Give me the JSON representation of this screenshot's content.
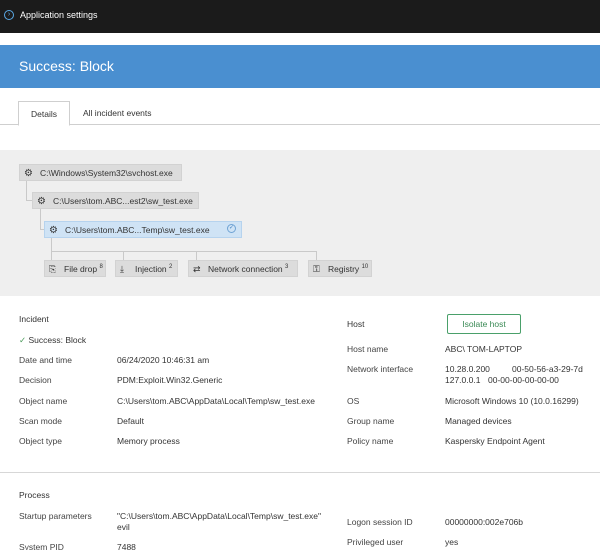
{
  "titlebar": {
    "title": "Application settings",
    "icon": "chevron-right-icon"
  },
  "header": {
    "title": "Success: Block",
    "color": "#4a8fd0"
  },
  "tabs": [
    {
      "label": "Details"
    },
    {
      "label": "All incident events"
    }
  ],
  "tree": {
    "root": "C:\\Windows\\System32\\svchost.exe",
    "child": "C:\\Users\\tom.ABC...est2\\sw_test.exe",
    "selected": "C:\\Users\\tom.ABC...Temp\\sw_test.exe",
    "leaves": [
      {
        "label": "File drop",
        "count": "8"
      },
      {
        "label": "Injection",
        "count": "2"
      },
      {
        "label": "Network connection",
        "count": "3"
      },
      {
        "label": "Registry",
        "count": "10"
      }
    ]
  },
  "incident": {
    "heading": "Incident",
    "status_check": "✓",
    "status": "Success: Block",
    "rows": [
      {
        "label": "Date and time",
        "value": "06/24/2020 10:46:31 am"
      },
      {
        "label": "Decision",
        "value": "PDM:Exploit.Win32.Generic"
      },
      {
        "label": "Object name",
        "value": "C:\\Users\\tom.ABC\\AppData\\Local\\Temp\\sw_test.exe"
      },
      {
        "label": "Scan mode",
        "value": "Default"
      },
      {
        "label": "Object type",
        "value": "Memory process"
      }
    ]
  },
  "host": {
    "heading": "Host",
    "isolate_button": "Isolate host",
    "host_name_label": "Host name",
    "host_name": "ABC\\ TOM-LAPTOP",
    "network_label": "Network interface",
    "net1_ip": "10.28.0.200",
    "net1_mac": "00-50-56-a3-29-7d",
    "net2_ip": "127.0.0.1",
    "net2_mac": "00-00-00-00-00-00",
    "os_label": "OS",
    "os": "Microsoft Windows 10 (10.0.16299)",
    "group_label": "Group name",
    "group": "Managed devices",
    "policy_label": "Policy name",
    "policy": "Kaspersky Endpoint Agent"
  },
  "process": {
    "heading": "Process",
    "startup_label": "Startup parameters",
    "startup_line1": "\"C:\\Users\\tom.ABC\\AppData\\Local\\Temp\\sw_test.exe\"",
    "startup_line2": "evil",
    "pid_label": "System PID",
    "pid": "7488",
    "logon_label": "Logon session ID",
    "logon": "00000000:002e706b",
    "priv_label": "Privileged user",
    "priv": "yes"
  }
}
